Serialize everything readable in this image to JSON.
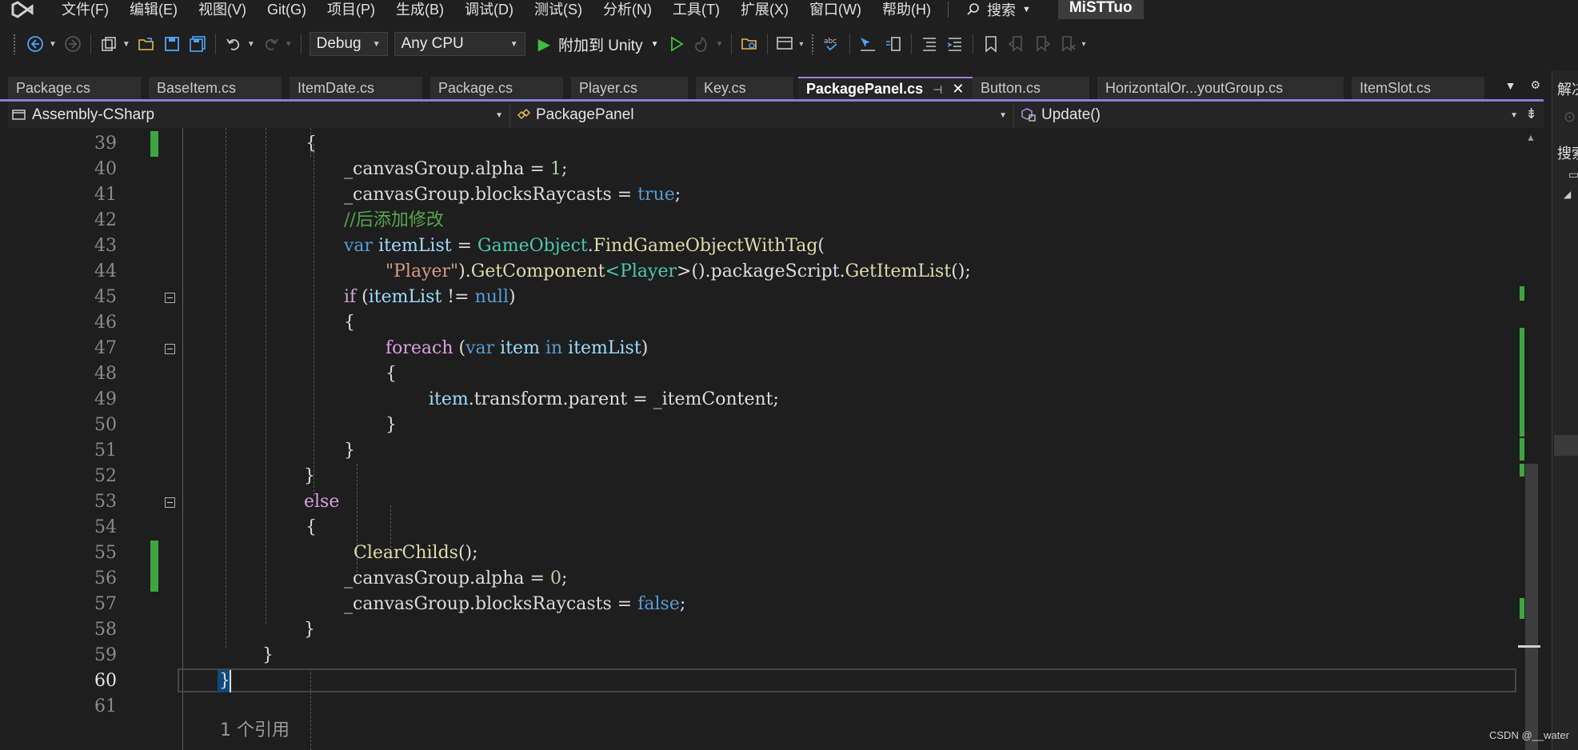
{
  "menu": {
    "items": [
      "文件(F)",
      "编辑(E)",
      "视图(V)",
      "Git(G)",
      "项目(P)",
      "生成(B)",
      "调试(D)",
      "测试(S)",
      "分析(N)",
      "工具(T)",
      "扩展(X)",
      "窗口(W)",
      "帮助(H)"
    ],
    "search_label": "搜索",
    "solution_name": "MiSTTuo"
  },
  "toolbar": {
    "configuration": "Debug",
    "platform": "Any CPU",
    "run_label": "附加到 Unity"
  },
  "tabs": [
    {
      "label": "Package.cs",
      "active": false
    },
    {
      "label": "BaseItem.cs",
      "active": false
    },
    {
      "label": "ItemDate.cs",
      "active": false
    },
    {
      "label": "Package.cs",
      "active": false
    },
    {
      "label": "Player.cs",
      "active": false
    },
    {
      "label": "Key.cs",
      "active": false
    },
    {
      "label": "PackagePanel.cs",
      "active": true
    },
    {
      "label": "Button.cs",
      "active": false
    },
    {
      "label": "HorizontalOr...youtGroup.cs",
      "active": false
    },
    {
      "label": "ItemSlot.cs",
      "active": false
    }
  ],
  "navbar": {
    "project": "Assembly-CSharp",
    "type": "PackagePanel",
    "member": "Update()"
  },
  "editor": {
    "current_line": 60,
    "line_numbers": [
      39,
      40,
      41,
      42,
      43,
      44,
      45,
      46,
      47,
      48,
      49,
      50,
      51,
      52,
      53,
      54,
      55,
      56,
      57,
      58,
      59,
      60,
      61
    ],
    "tokens": {
      "canvas_group": "_canvasGroup",
      "alpha": "alpha",
      "blocks_raycasts": "blocksRaycasts",
      "true_kw": "true",
      "false_kw": "false",
      "one": "1",
      "zero": "0",
      "comment": "//后添加修改",
      "var_kw": "var",
      "item_list": "itemList",
      "game_object": "GameObject",
      "find_tag": "FindGameObjectWithTag",
      "player_str": "\"Player\"",
      "get_component": "GetComponent",
      "player_type": "Player",
      "package_script": "packageScript",
      "get_item_list": "GetItemList",
      "if_kw": "if",
      "null_kw": "null",
      "foreach_kw": "foreach",
      "item": "item",
      "in_kw": "in",
      "transform": "transform",
      "parent": "parent",
      "item_content": "_itemContent",
      "else_kw": "else",
      "clear_childs": "ClearChilds"
    },
    "codelens": "1 个引用"
  },
  "solution_explorer": {
    "title": "解决",
    "search": "搜索"
  },
  "watermark": "CSDN @__water",
  "colors": {
    "keyword": "#569cd6",
    "control_keyword": "#d8a0df",
    "type": "#4ec9b0",
    "method": "#dcdcaa",
    "string": "#d69d85",
    "number": "#b5cea8",
    "comment": "#57a64a",
    "change_marker": "#3ea63e",
    "active_tab_accent": "#9b82d9"
  },
  "icons": [
    "vs-logo-icon",
    "search-icon",
    "back-icon",
    "forward-icon",
    "new-project-icon",
    "open-folder-icon",
    "save-icon",
    "save-all-icon",
    "undo-icon",
    "redo-icon",
    "play-icon",
    "start-without-debug-icon",
    "hot-reload-icon",
    "pin-icon",
    "close-icon",
    "dropdown-icon",
    "settings-icon",
    "split-editor-icon"
  ]
}
